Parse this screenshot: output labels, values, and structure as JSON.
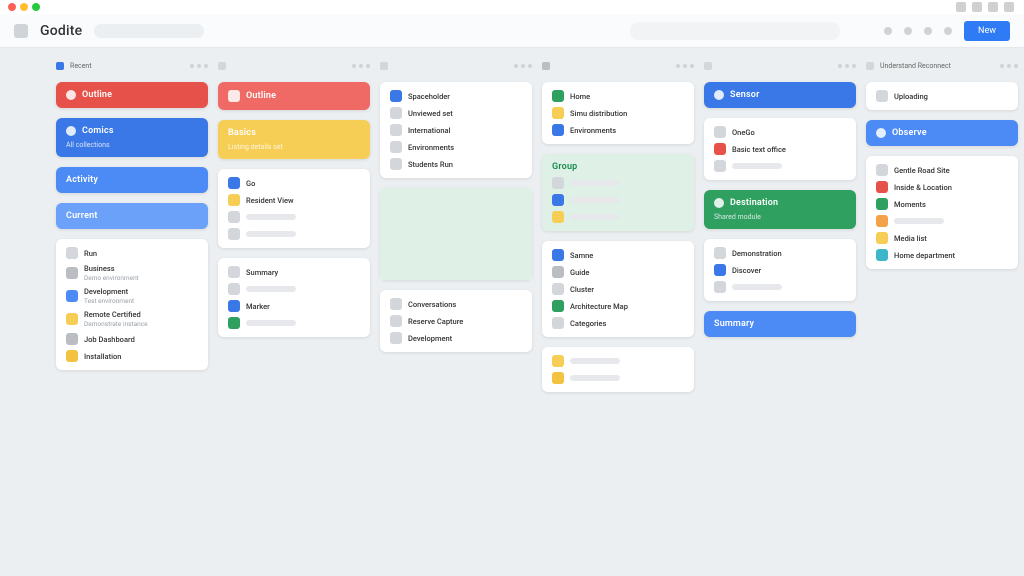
{
  "mac": {},
  "header": {
    "brand": "Godite",
    "button": "New"
  },
  "columns": [
    {
      "head": {
        "icon": "b-blue",
        "label": "Recent"
      },
      "cards": [
        {
          "type": "fill",
          "bg": "b-red",
          "icon": "iccirc",
          "title": "Outline",
          "sub": ""
        },
        {
          "type": "fill",
          "bg": "b-blue",
          "icon": "iccirc",
          "title": "Comics",
          "sub": "All collections"
        },
        {
          "type": "fill",
          "bg": "b-blue2",
          "icon": "",
          "title": "Activity",
          "sub": ""
        },
        {
          "type": "fill",
          "bg": "b-blue3",
          "icon": "",
          "title": "Current",
          "sub": ""
        },
        {
          "type": "list",
          "items": [
            {
              "ic": "b-gry2",
              "t": "Run",
              "s": ""
            },
            {
              "ic": "b-gry3",
              "t": "Business",
              "s": "Demo environment"
            },
            {
              "ic": "b-blue2",
              "t": "Development",
              "s": "Test environment"
            },
            {
              "ic": "b-yel",
              "t": "Remote Certified",
              "s": "Demonstrate instance"
            },
            {
              "ic": "b-gry3",
              "t": "Job Dashboard",
              "s": ""
            },
            {
              "ic": "b-yel2",
              "t": "Installation",
              "s": ""
            }
          ]
        }
      ]
    },
    {
      "head": {
        "icon": "b-gry2",
        "label": ""
      },
      "cards": [
        {
          "type": "fill",
          "bg": "b-red2",
          "icon": "ic",
          "title": "Outline",
          "sub": ""
        },
        {
          "type": "fill",
          "bg": "b-yel",
          "icon": "",
          "title": "Basics",
          "sub": "Listing details set"
        },
        {
          "type": "list",
          "items": [
            {
              "ic": "b-blue",
              "t": "Go",
              "s": ""
            },
            {
              "ic": "b-yel",
              "t": "Resident View",
              "s": ""
            },
            {
              "ic": "b-gry2",
              "t": "",
              "s": ""
            },
            {
              "ic": "b-gry2",
              "t": "",
              "s": ""
            }
          ]
        },
        {
          "type": "list",
          "items": [
            {
              "ic": "b-gry2",
              "t": "Summary",
              "s": ""
            },
            {
              "ic": "b-gry2",
              "t": "",
              "s": ""
            },
            {
              "ic": "b-blue",
              "t": "Marker",
              "s": ""
            },
            {
              "ic": "b-grn",
              "t": "",
              "s": ""
            }
          ]
        }
      ]
    },
    {
      "head": {
        "icon": "b-gry2",
        "label": ""
      },
      "cards": [
        {
          "type": "list",
          "items": [
            {
              "ic": "b-blue",
              "t": "Spaceholder",
              "s": ""
            },
            {
              "ic": "b-gry2",
              "t": "Unviewed set",
              "s": ""
            },
            {
              "ic": "b-gry2",
              "t": "International",
              "s": ""
            },
            {
              "ic": "b-gry2",
              "t": "Environments",
              "s": ""
            },
            {
              "ic": "b-gry2",
              "t": "Students Run",
              "s": ""
            }
          ]
        },
        {
          "type": "img",
          "bg": "b-grn3",
          "title": "",
          "sub": ""
        },
        {
          "type": "list",
          "items": [
            {
              "ic": "b-gry2",
              "t": "Conversations",
              "s": ""
            },
            {
              "ic": "b-gry2",
              "t": "Reserve Capture",
              "s": ""
            },
            {
              "ic": "b-gry2",
              "t": "Development",
              "s": ""
            }
          ]
        }
      ]
    },
    {
      "head": {
        "icon": "b-gry3",
        "label": ""
      },
      "cards": [
        {
          "type": "list",
          "items": [
            {
              "ic": "b-grn",
              "t": "Home",
              "s": ""
            },
            {
              "ic": "b-yel",
              "t": "Simu distribution",
              "s": ""
            },
            {
              "ic": "b-blue",
              "t": "Environments",
              "s": ""
            }
          ]
        },
        {
          "type": "list",
          "title": "Group",
          "items": [
            {
              "ic": "b-gry2",
              "t": "",
              "s": ""
            },
            {
              "ic": "b-blue",
              "t": "",
              "s": ""
            },
            {
              "ic": "b-yel",
              "t": "",
              "s": ""
            }
          ],
          "bg": "b-grn3"
        },
        {
          "type": "list",
          "items": [
            {
              "ic": "b-blue",
              "t": "Samne",
              "s": ""
            },
            {
              "ic": "b-gry3",
              "t": "Guide",
              "s": ""
            },
            {
              "ic": "b-gry2",
              "t": "Cluster",
              "s": ""
            },
            {
              "ic": "b-grn",
              "t": "Architecture Map",
              "s": ""
            },
            {
              "ic": "b-gry2",
              "t": "Categories",
              "s": ""
            }
          ]
        },
        {
          "type": "list",
          "items": [
            {
              "ic": "b-yel",
              "t": "",
              "s": ""
            },
            {
              "ic": "b-yel2",
              "t": "",
              "s": ""
            }
          ]
        }
      ]
    },
    {
      "head": {
        "icon": "b-gry2",
        "label": ""
      },
      "cards": [
        {
          "type": "fill",
          "bg": "b-blue",
          "icon": "iccirc",
          "title": "Sensor",
          "sub": ""
        },
        {
          "type": "list",
          "items": [
            {
              "ic": "b-gry2",
              "t": "OneGo",
              "s": ""
            },
            {
              "ic": "b-red",
              "t": "Basic text office",
              "s": ""
            },
            {
              "ic": "b-gry2",
              "t": "",
              "s": ""
            }
          ]
        },
        {
          "type": "fill",
          "bg": "b-grn",
          "icon": "iccirc",
          "title": "Destination",
          "sub": "Shared module"
        },
        {
          "type": "list",
          "items": [
            {
              "ic": "b-gry2",
              "t": "Demonstration",
              "s": ""
            },
            {
              "ic": "b-blue",
              "t": "Discover",
              "s": ""
            },
            {
              "ic": "b-gry2",
              "t": "",
              "s": ""
            }
          ]
        },
        {
          "type": "fill",
          "bg": "b-blue2",
          "icon": "",
          "title": "Summary",
          "sub": ""
        }
      ]
    },
    {
      "head": {
        "icon": "b-gry2",
        "label": "Understand Reconnect"
      },
      "cards": [
        {
          "type": "list",
          "items": [
            {
              "ic": "b-gry2",
              "t": "Uploading",
              "s": ""
            }
          ]
        },
        {
          "type": "fill",
          "bg": "b-blue2",
          "icon": "iccirc",
          "title": "Observe",
          "sub": ""
        },
        {
          "type": "list",
          "items": [
            {
              "ic": "b-gry2",
              "t": "Gentle Road Site",
              "s": ""
            },
            {
              "ic": "b-red",
              "t": "Inside & Location",
              "s": ""
            },
            {
              "ic": "b-grn",
              "t": "Moments",
              "s": ""
            },
            {
              "ic": "b-orng",
              "t": "",
              "s": ""
            },
            {
              "ic": "b-yel",
              "t": "Media list",
              "s": ""
            },
            {
              "ic": "b-cyan",
              "t": "Home department",
              "s": ""
            }
          ]
        }
      ]
    }
  ]
}
